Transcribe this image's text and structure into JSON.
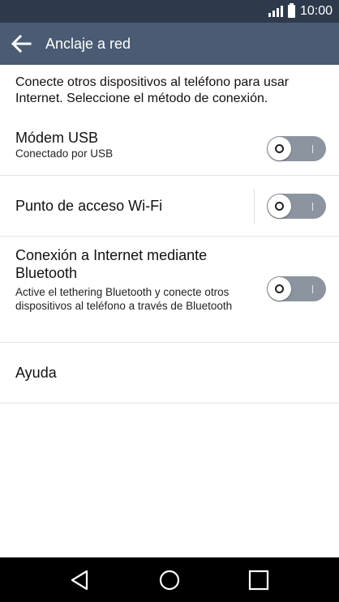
{
  "status_bar": {
    "time": "10:00",
    "icons": [
      "signal-icon",
      "battery-icon"
    ],
    "background": "#2e3a4c"
  },
  "app_bar": {
    "title": "Anclaje a red",
    "back_icon": "arrow-left-icon",
    "background": "#4a5b73"
  },
  "intro_text": "Conecte otros dispositivos al teléfono para usar Internet. Seleccione el método de conexión.",
  "settings": {
    "usb": {
      "title": "Módem USB",
      "subtitle": "Conectado por USB",
      "enabled": false
    },
    "wifi": {
      "title": "Punto de acceso Wi-Fi",
      "enabled": false
    },
    "bluetooth": {
      "title": "Conexión a Internet mediante Bluetooth",
      "subtitle": "Active el tethering Bluetooth y conecte otros dispositivos al teléfono a través de Bluetooth",
      "enabled": false
    },
    "help": {
      "title": "Ayuda"
    }
  },
  "toggle_colors": {
    "off_track": "#8c959f",
    "knob": "#ffffff"
  },
  "nav_bar": {
    "icons": [
      "back-triangle-icon",
      "home-circle-icon",
      "recents-square-icon"
    ]
  }
}
